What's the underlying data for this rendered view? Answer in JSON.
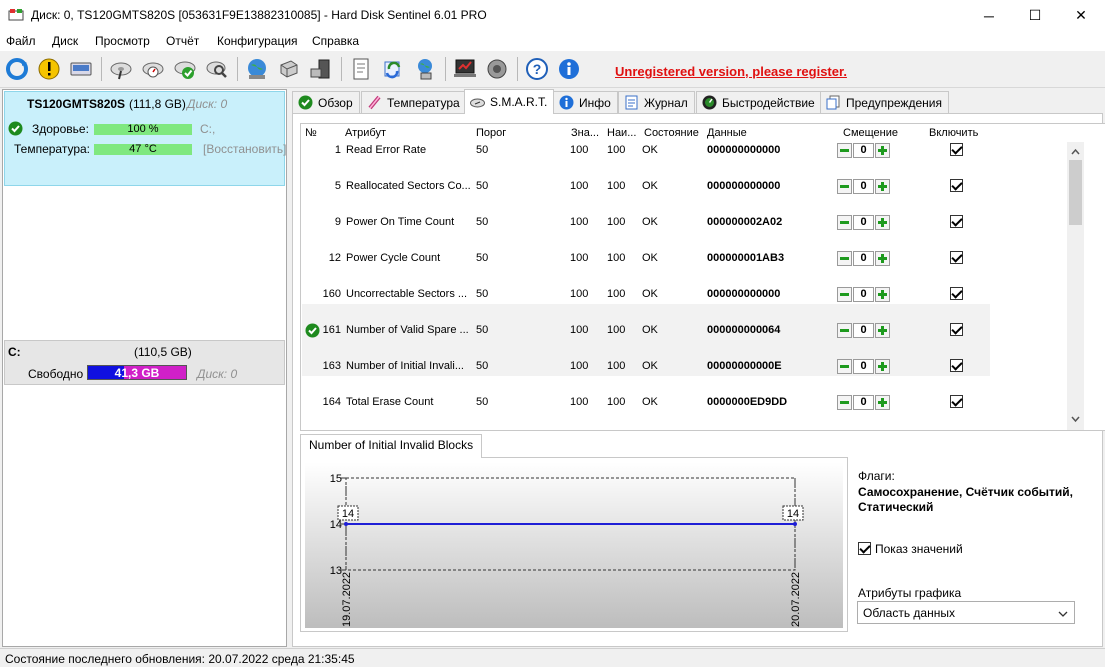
{
  "window": {
    "title": "Диск: 0, TS120GMTS820S [053631F9E13882310085]  -  Hard Disk Sentinel 6.01 PRO",
    "minimize": "─",
    "maximize": "☐",
    "close": "✕"
  },
  "menu": [
    "Файл",
    "Диск",
    "Просмотр",
    "Отчёт",
    "Конфигурация",
    "Справка"
  ],
  "toolbar": {
    "register_text": "Unregistered version, please register."
  },
  "disk": {
    "name": "TS120GMTS820S",
    "size": "(111,8 GB)",
    "index": "Диск: 0",
    "health_label": "Здоровье:",
    "health_value": "100 %",
    "health_percent": 100,
    "health_drive": "C:,",
    "temp_label": "Температура:",
    "temp_value": "47 °C",
    "restore": "[Восстановить]"
  },
  "partition": {
    "letter": "C:",
    "size": "(110,5 GB)",
    "free_label": "Свободно",
    "free_value": "41,3 GB",
    "free_fraction": 0.37,
    "disk_ref": "Диск: 0"
  },
  "tabs": [
    {
      "label": "Обзор"
    },
    {
      "label": "Температура"
    },
    {
      "label": "S.M.A.R.T."
    },
    {
      "label": "Инфо"
    },
    {
      "label": "Журнал"
    },
    {
      "label": "Быстродействие"
    },
    {
      "label": "Предупреждения"
    }
  ],
  "smart": {
    "headers": [
      "№",
      "Атрибут",
      "Порог",
      "Зна...",
      "Наи...",
      "Состояние",
      "Данные",
      "Смещение",
      "Включить"
    ],
    "rows": [
      {
        "id": "1",
        "name": "Read Error Rate",
        "threshold": "50",
        "value": "100",
        "worst": "100",
        "status": "OK",
        "data": "000000000000",
        "offset": "0"
      },
      {
        "id": "5",
        "name": "Reallocated Sectors Co...",
        "threshold": "50",
        "value": "100",
        "worst": "100",
        "status": "OK",
        "data": "000000000000",
        "offset": "0"
      },
      {
        "id": "9",
        "name": "Power On Time Count",
        "threshold": "50",
        "value": "100",
        "worst": "100",
        "status": "OK",
        "data": "000000002A02",
        "offset": "0"
      },
      {
        "id": "12",
        "name": "Power Cycle Count",
        "threshold": "50",
        "value": "100",
        "worst": "100",
        "status": "OK",
        "data": "000000001AB3",
        "offset": "0"
      },
      {
        "id": "160",
        "name": "Uncorrectable Sectors ...",
        "threshold": "50",
        "value": "100",
        "worst": "100",
        "status": "OK",
        "data": "000000000000",
        "offset": "0"
      },
      {
        "id": "161",
        "name": "Number of Valid Spare ...",
        "threshold": "50",
        "value": "100",
        "worst": "100",
        "status": "OK",
        "data": "000000000064",
        "offset": "0"
      },
      {
        "id": "163",
        "name": "Number of Initial Invali...",
        "threshold": "50",
        "value": "100",
        "worst": "100",
        "status": "OK",
        "data": "00000000000E",
        "offset": "0"
      },
      {
        "id": "164",
        "name": "Total Erase Count",
        "threshold": "50",
        "value": "100",
        "worst": "100",
        "status": "OK",
        "data": "0000000ED9DD",
        "offset": "0"
      }
    ]
  },
  "chart_tab": "Number of Initial Invalid Blocks",
  "chart_data": {
    "type": "line",
    "x": [
      "19.07.2022",
      "20.07.2022"
    ],
    "series": [
      {
        "values": [
          14,
          14
        ]
      }
    ],
    "data_labels": [
      "14",
      "14"
    ],
    "y_ticks": [
      "15",
      "14",
      "13"
    ],
    "ylim": [
      13,
      15
    ],
    "line_color": "#1f1fd6"
  },
  "side": {
    "flags_label": "Флаги:",
    "flags_value": "Самосохранение, Счётчик событий, Статический",
    "show_values": "Показ значений",
    "graph_attr_label": "Атрибуты графика",
    "graph_attr_value": "Область данных"
  },
  "status": "Состояние последнего обновления: 20.07.2022 среда 21:35:45"
}
